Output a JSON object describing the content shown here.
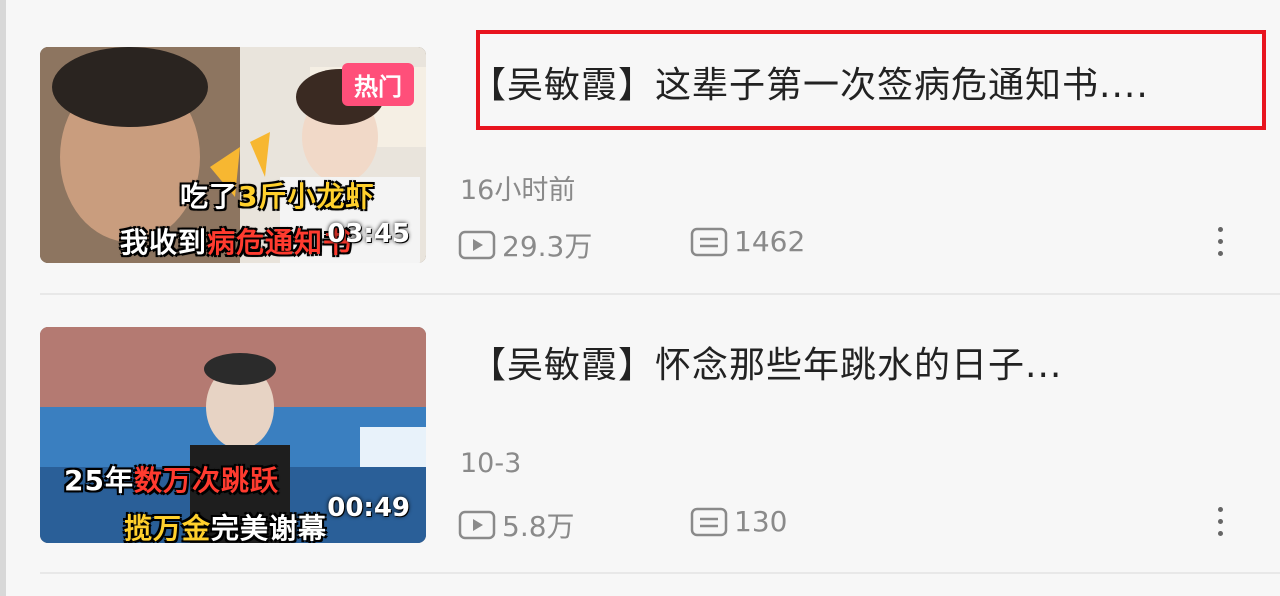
{
  "videos": [
    {
      "title": "【吴敏霞】这辈子第一次签病危通知书....",
      "badge": "热门",
      "caption_line1_a": "吃了",
      "caption_line1_b": "3斤",
      "caption_line1_c": "小龙虾",
      "caption_line2_a": "我收到",
      "caption_line2_b": "病危通知书",
      "duration": "03:45",
      "date": "16小时前",
      "views": "29.3万",
      "comments": "1462",
      "highlighted": true
    },
    {
      "title": "【吴敏霞】怀念那些年跳水的日子...",
      "caption_line1_a": "25年",
      "caption_line1_b": "数万次跳跃",
      "caption_line2_a": "揽万金",
      "caption_line2_b": "完美谢幕",
      "duration": "00:49",
      "date": "10-3",
      "views": "5.8万",
      "comments": "130",
      "highlighted": false
    }
  ],
  "icons": {
    "play": "play-count-icon",
    "comment": "comment-count-icon",
    "more": "more-vertical-icon"
  },
  "colors": {
    "highlight": "#e8141e",
    "badge": "#ff4f7a",
    "meta_text": "#8a8a8a"
  }
}
